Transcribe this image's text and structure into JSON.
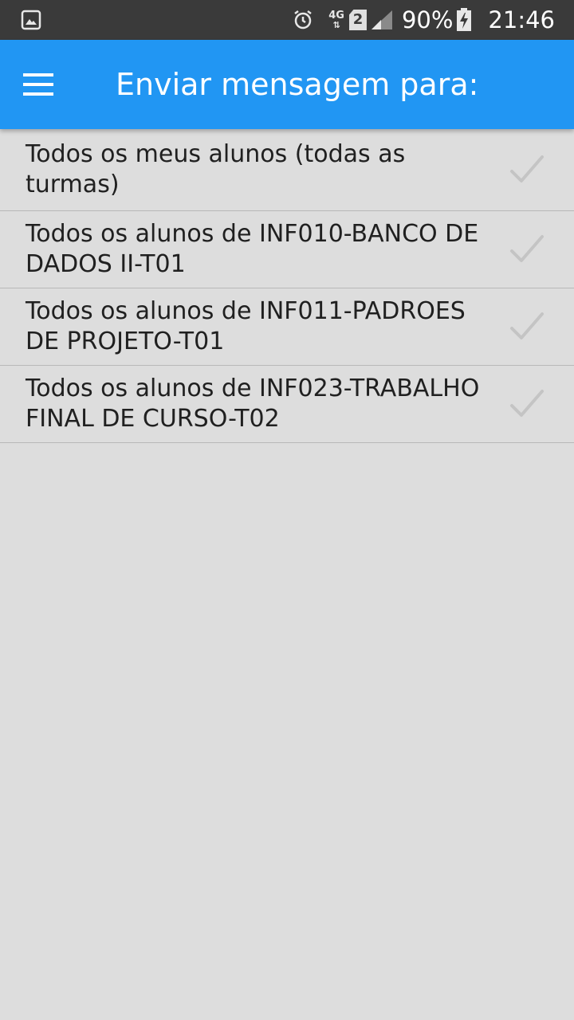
{
  "status_bar": {
    "battery_percent": "90%",
    "time": "21:46",
    "network_type": "4G",
    "sim_slot": "2",
    "icons": [
      "gallery-icon",
      "alarm-icon",
      "network-4g-icon",
      "sim-2-icon",
      "signal-icon",
      "battery-charging-icon"
    ]
  },
  "app_bar": {
    "title": "Enviar mensagem para:",
    "color": "#2196f3",
    "menu_icon": "hamburger-menu-icon"
  },
  "recipients": [
    {
      "label": "Todos os meus alunos (todas as turmas)",
      "checked": false
    },
    {
      "label": "Todos os alunos de INF010-BANCO DE DADOS II-T01",
      "checked": false
    },
    {
      "label": "Todos os alunos de INF011-PADROES DE PROJETO-T01",
      "checked": false
    },
    {
      "label": "Todos os alunos de INF023-TRABALHO FINAL DE CURSO-T02",
      "checked": false
    }
  ],
  "colors": {
    "background": "#dddddd",
    "status_bar": "#3a3a3a",
    "check_inactive": "#c4c4c4"
  }
}
